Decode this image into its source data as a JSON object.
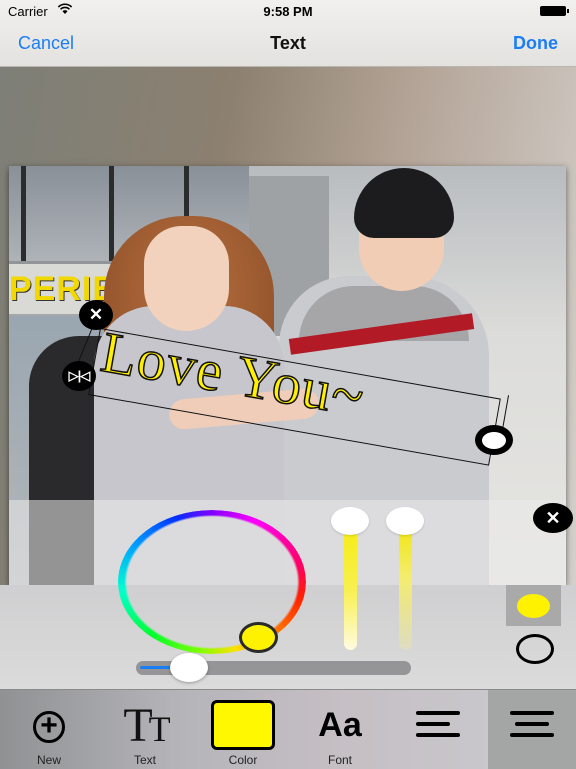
{
  "status_bar": {
    "carrier": "Carrier",
    "wifi_icon": "wifi-icon",
    "time": "9:58 PM",
    "battery_icon": "battery-icon"
  },
  "nav": {
    "cancel_label": "Cancel",
    "title": "Text",
    "done_label": "Done",
    "accent_color": "#1a7ef5"
  },
  "photo": {
    "sign_text": "PERIE",
    "description": "couple in matching grey polo shirts"
  },
  "sticker": {
    "text": "Love You~",
    "fill_color": "#ffef00",
    "stroke_color": "#111111",
    "handles": {
      "close_glyph": "✕",
      "flip_glyph": "▷|◁"
    }
  },
  "color_panel": {
    "close_glyph": "✕",
    "selected_color": "#fff200",
    "hue_knob_color": "#fff200",
    "slider_value_fraction": 0.18,
    "swatches": [
      {
        "name": "fill",
        "color": "#fff200",
        "selected": true
      },
      {
        "name": "outline",
        "color": "none",
        "selected": false
      }
    ]
  },
  "toolbar": {
    "items": [
      {
        "id": "new",
        "label": "New",
        "icon": "plus-circle-icon"
      },
      {
        "id": "text",
        "label": "Text",
        "icon": "text-size-icon",
        "glyph_big": "T",
        "glyph_small": "T"
      },
      {
        "id": "color",
        "label": "Color",
        "icon": "color-swatch-icon",
        "color": "#fff800"
      },
      {
        "id": "font",
        "label": "Font",
        "icon": "font-icon",
        "glyph": "Aa"
      },
      {
        "id": "align-left",
        "label": "",
        "icon": "align-left-icon"
      },
      {
        "id": "align-center",
        "label": "",
        "icon": "align-center-icon",
        "selected": true
      }
    ]
  }
}
